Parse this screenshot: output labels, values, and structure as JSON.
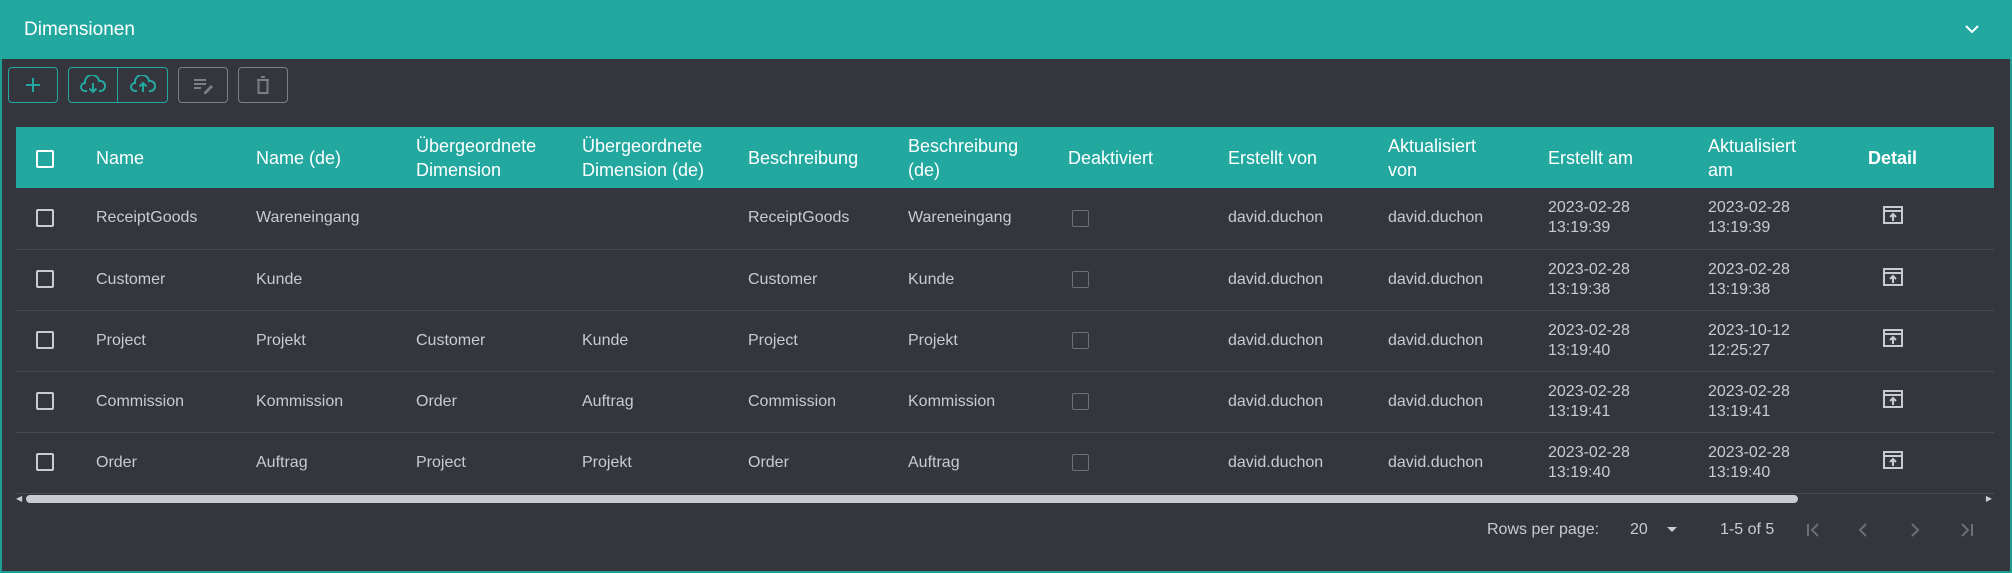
{
  "panel": {
    "title": "Dimensionen"
  },
  "toolbar": {
    "buttons": [
      {
        "icon": "plus-icon"
      },
      {
        "icon": "cloud-download-icon"
      },
      {
        "icon": "cloud-upload-icon"
      },
      {
        "icon": "edit-list-icon"
      },
      {
        "icon": "trash-icon"
      }
    ]
  },
  "table": {
    "headers": {
      "name": "Name",
      "name_de": "Name (de)",
      "parent_line1": "Übergeordnete",
      "parent_line2": "Dimension",
      "parent_de_line1": "Übergeordnete",
      "parent_de_line2": "Dimension (de)",
      "desc": "Beschreibung",
      "desc_de_line1": "Beschreibung",
      "desc_de_line2": "(de)",
      "deactivated": "Deaktiviert",
      "created_by": "Erstellt von",
      "updated_by_line1": "Aktualisiert",
      "updated_by_line2": "von",
      "created_at": "Erstellt am",
      "updated_at_line1": "Aktualisiert",
      "updated_at_line2": "am",
      "detail": "Detail"
    },
    "rows": [
      {
        "name": "ReceiptGoods",
        "name_de": "Wareneingang",
        "parent": "",
        "parent_de": "",
        "desc": "ReceiptGoods",
        "desc_de": "Wareneingang",
        "deactivated": false,
        "created_by": "david.duchon",
        "updated_by": "david.duchon",
        "created_date": "2023-02-28",
        "created_time": "13:19:39",
        "updated_date": "2023-02-28",
        "updated_time": "13:19:39"
      },
      {
        "name": "Customer",
        "name_de": "Kunde",
        "parent": "",
        "parent_de": "",
        "desc": "Customer",
        "desc_de": "Kunde",
        "deactivated": false,
        "created_by": "david.duchon",
        "updated_by": "david.duchon",
        "created_date": "2023-02-28",
        "created_time": "13:19:38",
        "updated_date": "2023-02-28",
        "updated_time": "13:19:38"
      },
      {
        "name": "Project",
        "name_de": "Projekt",
        "parent": "Customer",
        "parent_de": "Kunde",
        "desc": "Project",
        "desc_de": "Projekt",
        "deactivated": false,
        "created_by": "david.duchon",
        "updated_by": "david.duchon",
        "created_date": "2023-02-28",
        "created_time": "13:19:40",
        "updated_date": "2023-10-12",
        "updated_time": "12:25:27"
      },
      {
        "name": "Commission",
        "name_de": "Kommission",
        "parent": "Order",
        "parent_de": "Auftrag",
        "desc": "Commission",
        "desc_de": "Kommission",
        "deactivated": false,
        "created_by": "david.duchon",
        "updated_by": "david.duchon",
        "created_date": "2023-02-28",
        "created_time": "13:19:41",
        "updated_date": "2023-02-28",
        "updated_time": "13:19:41"
      },
      {
        "name": "Order",
        "name_de": "Auftrag",
        "parent": "Project",
        "parent_de": "Projekt",
        "desc": "Order",
        "desc_de": "Auftrag",
        "deactivated": false,
        "created_by": "david.duchon",
        "updated_by": "david.duchon",
        "created_date": "2023-02-28",
        "created_time": "13:19:40",
        "updated_date": "2023-02-28",
        "updated_time": "13:19:40"
      }
    ]
  },
  "pagination": {
    "rows_per_page_label": "Rows per page:",
    "rows_per_page_value": "20",
    "range": "1-5 of 5"
  },
  "colors": {
    "accent": "#23a8a0",
    "background": "#34353d",
    "text": "#c9cbd2"
  }
}
